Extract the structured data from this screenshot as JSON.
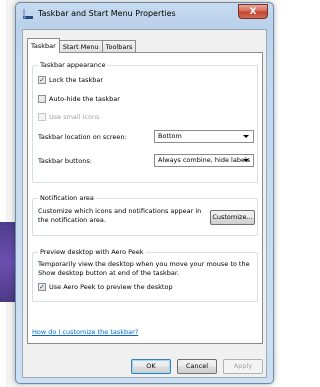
{
  "window": {
    "title": "Taskbar and Start Menu Properties",
    "close_glyph": "X"
  },
  "tabs": [
    {
      "label": "Taskbar"
    },
    {
      "label": "Start Menu"
    },
    {
      "label": "Toolbars"
    }
  ],
  "taskbar_appearance": {
    "group_label": "Taskbar appearance",
    "lock": {
      "label": "Lock the taskbar",
      "checked": true
    },
    "autohide": {
      "label": "Auto-hide the taskbar",
      "checked": false
    },
    "small_icons": {
      "label": "Use small icons",
      "checked": false,
      "disabled": true
    },
    "location_label": "Taskbar location on screen:",
    "location_value": "Bottom",
    "buttons_label": "Taskbar buttons:",
    "buttons_value": "Always combine, hide labels"
  },
  "notification_area": {
    "group_label": "Notification area",
    "description": "Customize which icons and notifications appear in the notification area.",
    "customize_button": "Customize..."
  },
  "aero_peek": {
    "group_label": "Preview desktop with Aero Peek",
    "description": "Temporarily view the desktop when you move your mouse to the Show desktop button at end of the taskbar.",
    "use_peek": {
      "label": "Use Aero Peek to preview the desktop",
      "checked": true
    }
  },
  "help_link": "How do I customize the taskbar?",
  "footer": {
    "ok": "OK",
    "cancel": "Cancel",
    "apply": "Apply"
  }
}
